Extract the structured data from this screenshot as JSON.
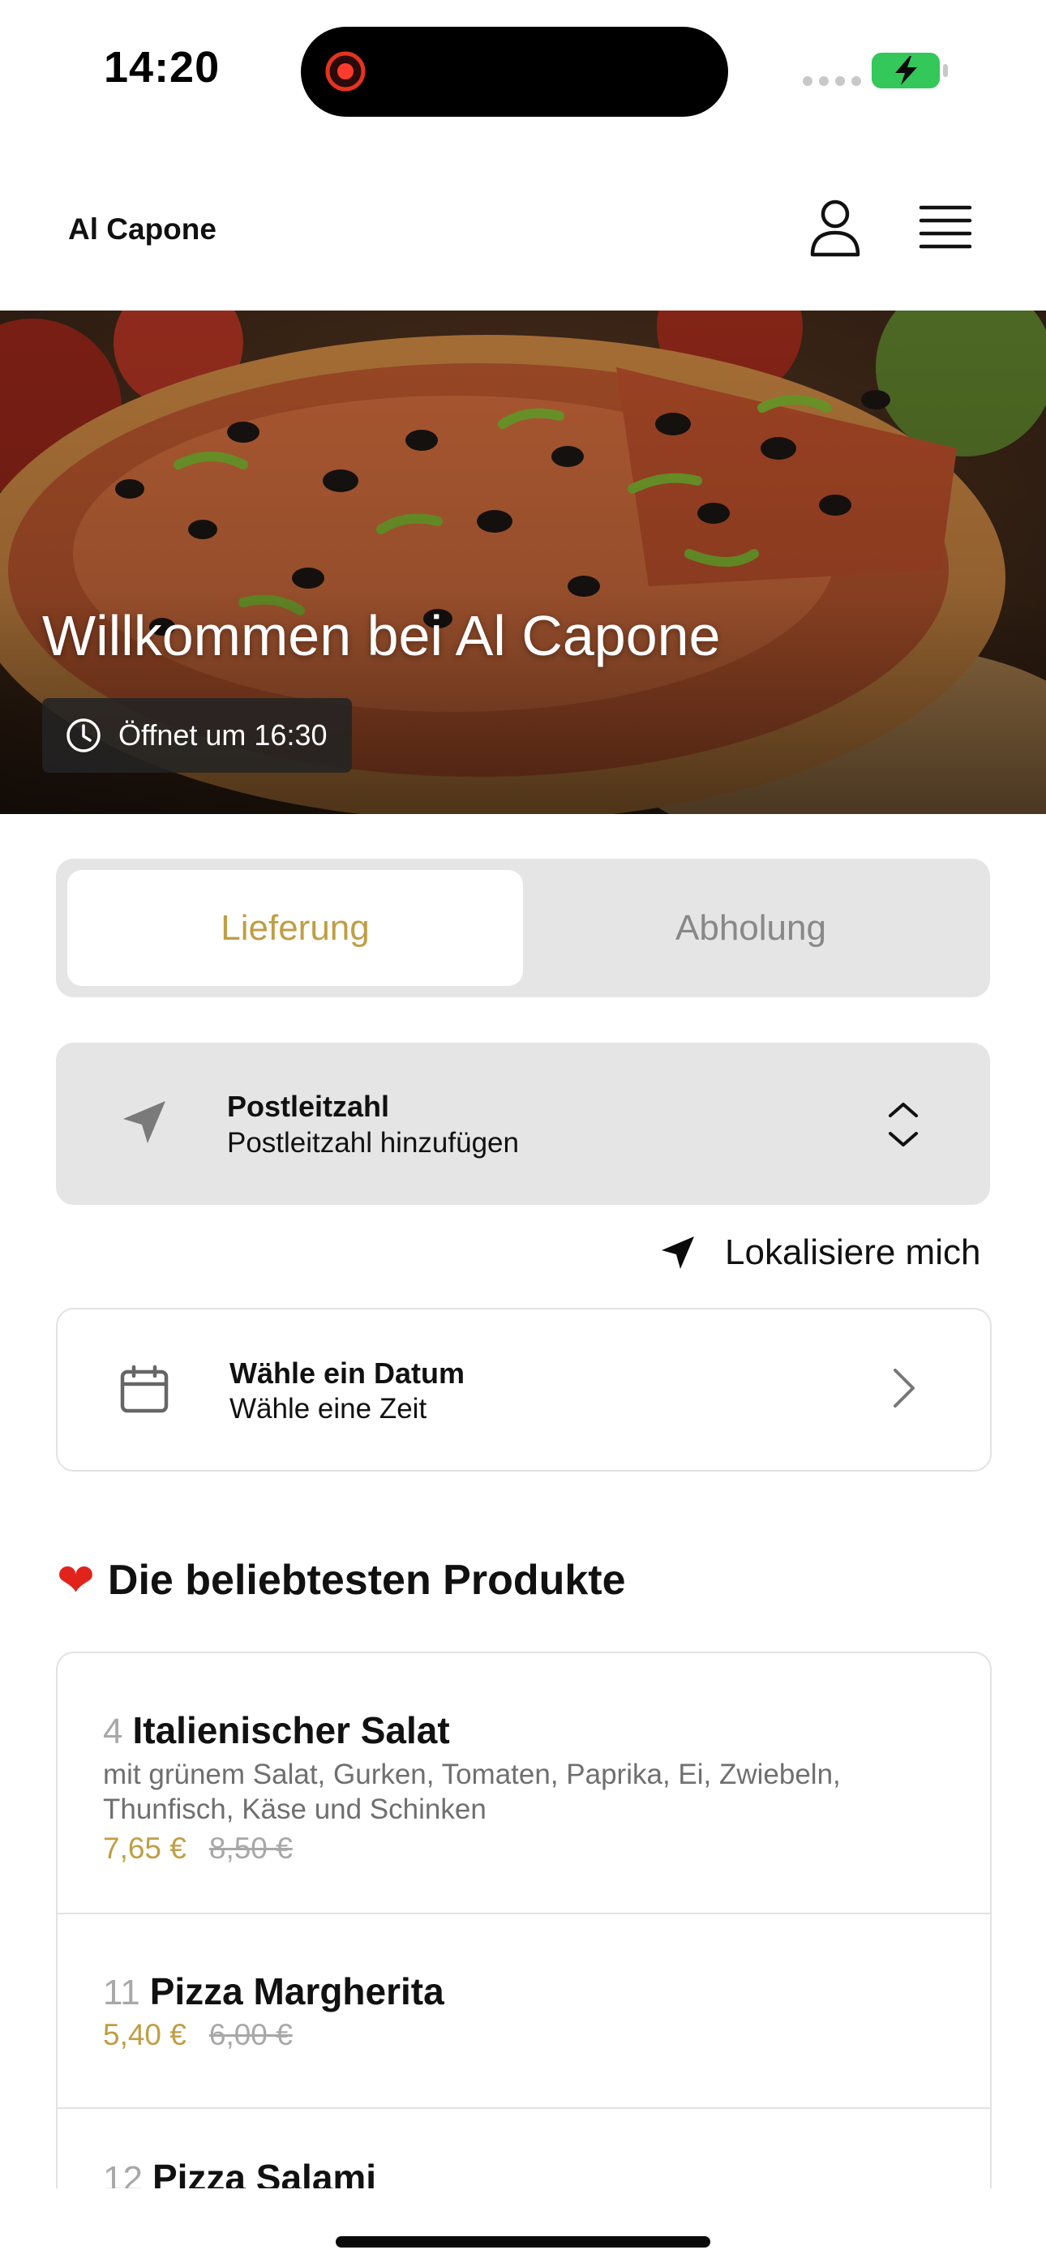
{
  "status_bar": {
    "time": "14:20"
  },
  "header": {
    "title": "Al Capone"
  },
  "hero": {
    "title": "Willkommen bei Al Capone",
    "hours": "Öffnet um 16:30"
  },
  "mode": {
    "delivery": "Lieferung",
    "pickup": "Abholung",
    "selected": "delivery"
  },
  "postcode": {
    "label": "Postleitzahl",
    "placeholder": "Postleitzahl hinzufügen"
  },
  "locate": {
    "label": "Lokalisiere mich"
  },
  "schedule": {
    "date_label": "Wähle ein Datum",
    "time_label": "Wähle eine Zeit"
  },
  "popular": {
    "heading": "Die beliebtesten Produkte",
    "items": [
      {
        "number": "4",
        "name": "Italienischer Salat",
        "description": "mit grünem Salat, Gurken, Tomaten, Paprika, Ei, Zwiebeln, Thunfisch, Käse und Schinken",
        "price": "7,65 €",
        "old_price": "8,50 €"
      },
      {
        "number": "11",
        "name": "Pizza Margherita",
        "description": "",
        "price": "5,40 €",
        "old_price": "6,00 €"
      },
      {
        "number": "12",
        "name": "Pizza Salami",
        "description": "",
        "price": "",
        "old_price": ""
      }
    ]
  },
  "colors": {
    "accent": "#bf9e45",
    "muted": "#888888",
    "card_gray": "#e5e5e5",
    "border": "#e2e2e2",
    "battery_green": "#34c759"
  }
}
